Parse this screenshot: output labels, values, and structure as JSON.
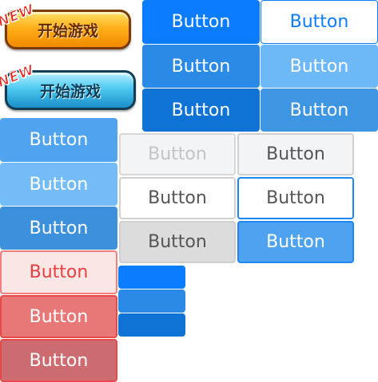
{
  "game_buttons": {
    "orange": {
      "label": "开始游戏",
      "badge": "NEW"
    },
    "blue": {
      "label": "开始游戏",
      "badge": "NEW"
    }
  },
  "buttons": {
    "primary_solid": "Button",
    "primary_outline": "Button",
    "primary_mid": "Button",
    "primary_light": "Button",
    "primary_dark": "Button",
    "primary_medium": "Button",
    "left_blue_1": "Button",
    "left_blue_2": "Button",
    "left_blue_3": "Button",
    "default_disabled": "Button",
    "default_gray": "Button",
    "default_white": "Button",
    "default_focused": "Button",
    "default_pressed": "Button",
    "default_blue": "Button",
    "danger_outline": "Button",
    "danger_mid": "Button",
    "danger_dark": "Button"
  },
  "colors": {
    "primary": "#0a7cff",
    "danger": "#e84a4a",
    "default_border": "#c8c8c8"
  }
}
